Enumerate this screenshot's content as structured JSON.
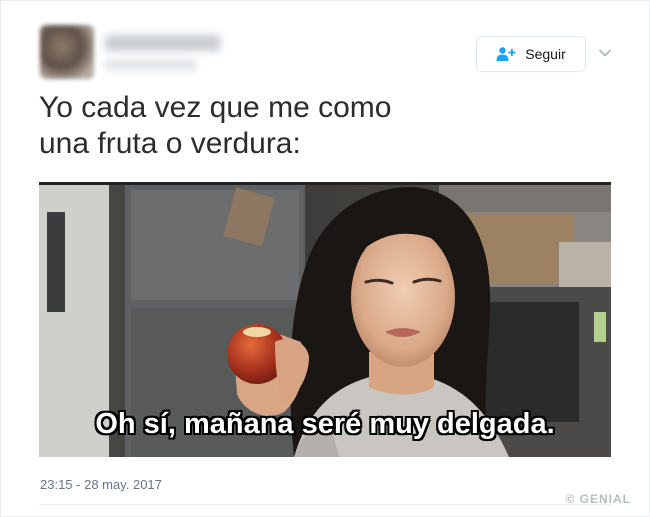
{
  "tweet": {
    "follow_label": "Seguir",
    "text_lines": [
      "Yo cada vez que me como",
      "una fruta o verdura:"
    ],
    "subtitle": "Oh sí, mañana seré muy delgada.",
    "timestamp": "23:15 - 28 may. 2017",
    "watermark": "© GENIAL"
  },
  "icons": {
    "follow": "person-add-icon",
    "caret": "chevron-down-icon"
  },
  "colors": {
    "twitter_blue": "#1da1f2",
    "text": "#2c2c2c",
    "meta": "#657786"
  }
}
